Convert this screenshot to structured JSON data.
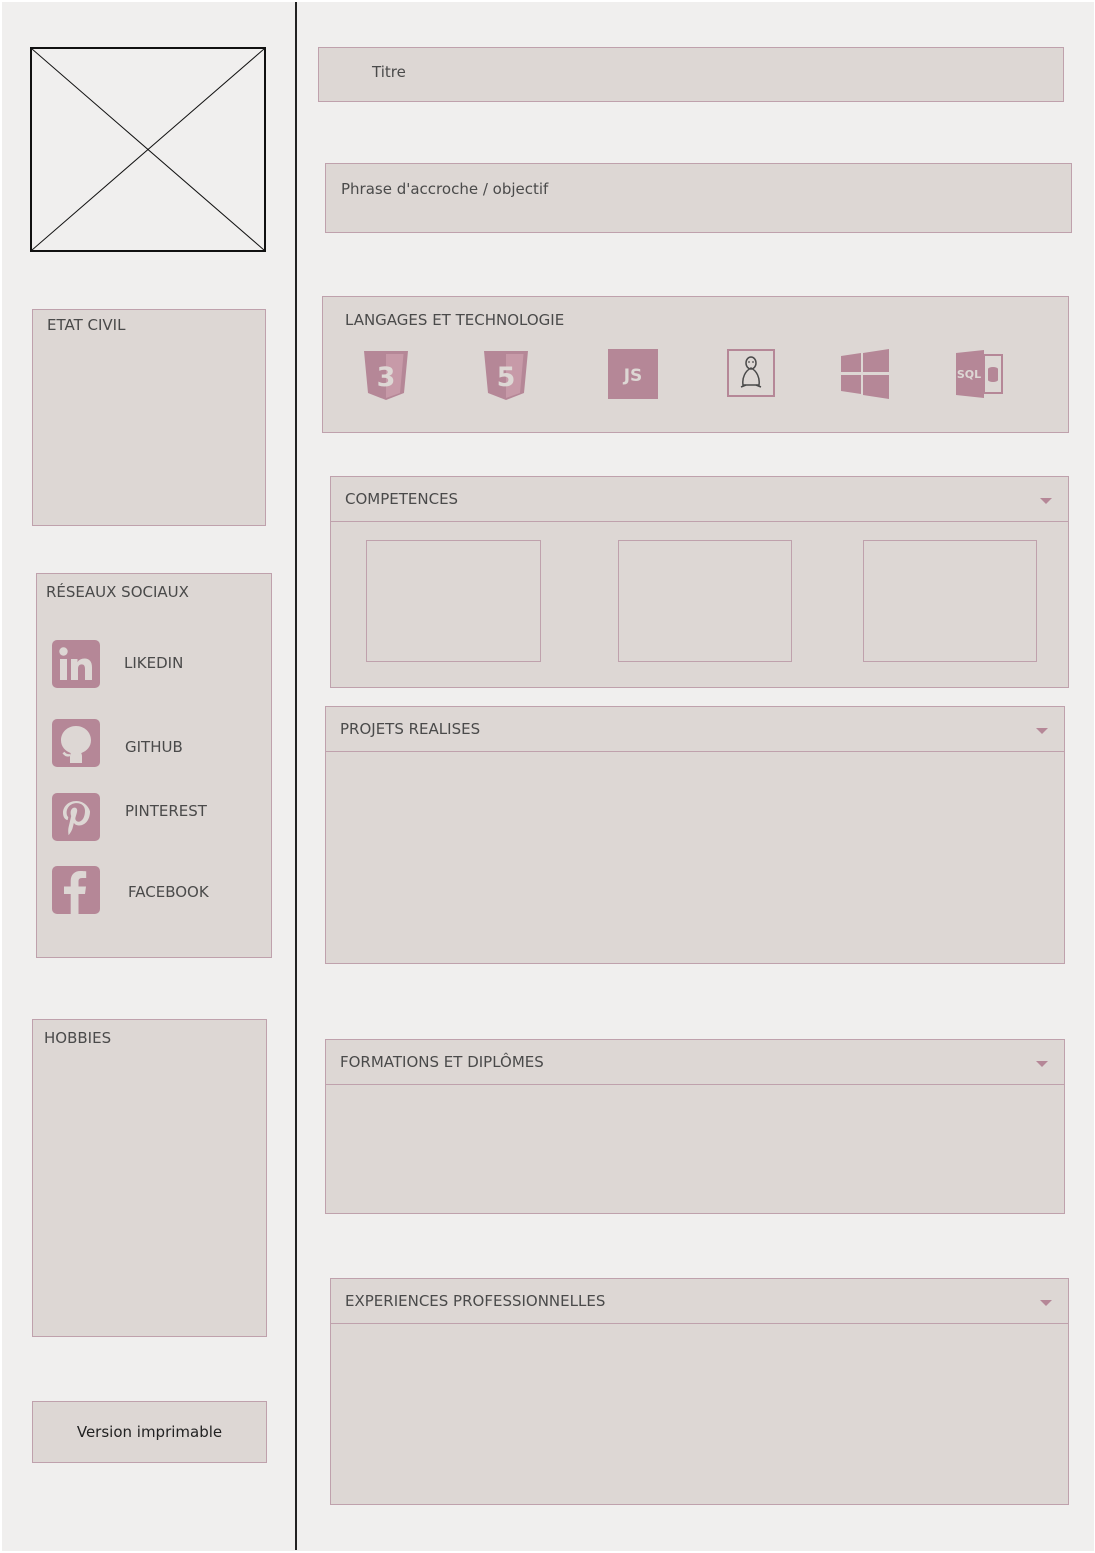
{
  "colors": {
    "accent": "#b58797",
    "panel": "#ddd7d4",
    "border": "#bfa1ac",
    "page_bg": "#f0efee"
  },
  "photo": {
    "icon": "image-placeholder-icon"
  },
  "header": {
    "title": "Titre",
    "tagline": "Phrase d'accroche / objectif"
  },
  "sidebar": {
    "civil_label": "ETAT CIVIL",
    "social_label": "RÉSEAUX SOCIAUX",
    "social": [
      {
        "label": "LIKEDIN",
        "icon": "linkedin-icon"
      },
      {
        "label": "GITHUB",
        "icon": "github-icon"
      },
      {
        "label": "PINTEREST",
        "icon": "pinterest-icon"
      },
      {
        "label": "FACEBOOK",
        "icon": "facebook-icon"
      }
    ],
    "hobbies_label": "HOBBIES",
    "print_button": "Version imprimable"
  },
  "tech": {
    "label": "LANGAGES ET TECHNOLOGIE",
    "icons": [
      {
        "name": "css3-icon",
        "text": "3"
      },
      {
        "name": "html5-icon",
        "text": "5"
      },
      {
        "name": "javascript-icon",
        "text": "JS"
      },
      {
        "name": "linux-icon"
      },
      {
        "name": "windows-icon"
      },
      {
        "name": "sql-database-icon",
        "text": "SQL"
      }
    ]
  },
  "sections": {
    "competences": "COMPETENCES",
    "projects": "PROJETS REALISES",
    "education": "FORMATIONS ET DIPLÔMES",
    "experience": "EXPERIENCES PROFESSIONNELLES"
  }
}
